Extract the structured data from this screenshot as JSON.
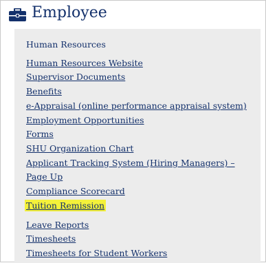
{
  "header": {
    "title": "Employee",
    "icon": "briefcase-icon",
    "accent_color": "#13306b"
  },
  "section": {
    "label": "Human Resources"
  },
  "links": [
    "Human Resources Website",
    "Supervisor Documents",
    "Benefits",
    "e-Appraisal (online performance appraisal system)",
    "Employment Opportunities",
    "Forms",
    "SHU Organization Chart",
    "Applicant Tracking System (Hiring Managers) –",
    "Page Up",
    "Compliance Scorecard",
    "Tuition Remission",
    "Leave Reports",
    "Timesheets",
    "Timesheets for Student Workers"
  ],
  "highlighted_link": "Tuition Remission",
  "highlight_color": "#f4f13a"
}
